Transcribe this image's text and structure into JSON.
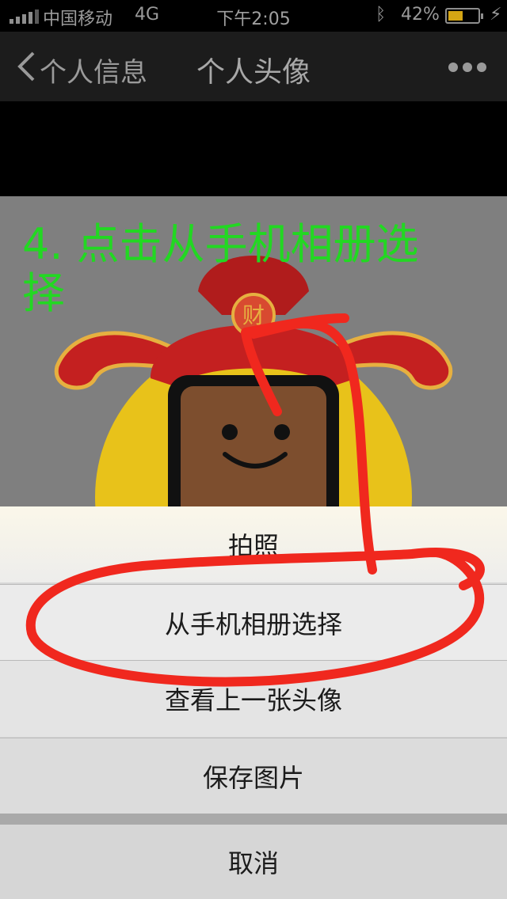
{
  "status_bar": {
    "carrier": "中国移动",
    "network": "4G",
    "time": "下午2:05",
    "battery_percent": "42%",
    "battery_level": 0.42
  },
  "nav": {
    "back_label": "个人信息",
    "title": "个人头像",
    "more_icon": "ellipsis-icon"
  },
  "annotation": {
    "instruction": "4. 点击从手机相册选择",
    "color": "#22d822"
  },
  "action_sheet": {
    "items": [
      "拍照",
      "从手机相册选择",
      "查看上一张头像",
      "保存图片"
    ],
    "cancel": "取消"
  },
  "colors": {
    "markup_red": "#f0281e",
    "avatar_yellow": "#e8c21a",
    "hat_red": "#c42020"
  }
}
